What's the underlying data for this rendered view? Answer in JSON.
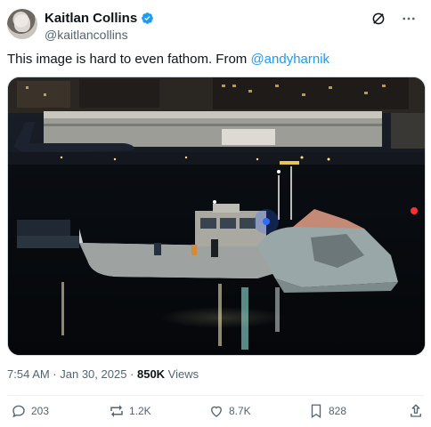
{
  "author": {
    "display_name": "Kaitlan Collins",
    "handle": "@kaitlancollins",
    "verified": true
  },
  "tweet": {
    "text_before": "This image is hard to even fathom. From ",
    "mention": "@andyharnik"
  },
  "media": {
    "icon": "photo-night-river-wreckage"
  },
  "meta": {
    "timestamp": "7:54 AM · Jan 30, 2025 · ",
    "views_count": "850K",
    "views_label": " Views"
  },
  "actions": {
    "replies": "203",
    "reposts": "1.2K",
    "likes": "8.7K",
    "bookmarks": "828"
  },
  "colors": {
    "accent": "#1d9bf0",
    "muted": "#536471",
    "text": "#0f1419"
  }
}
